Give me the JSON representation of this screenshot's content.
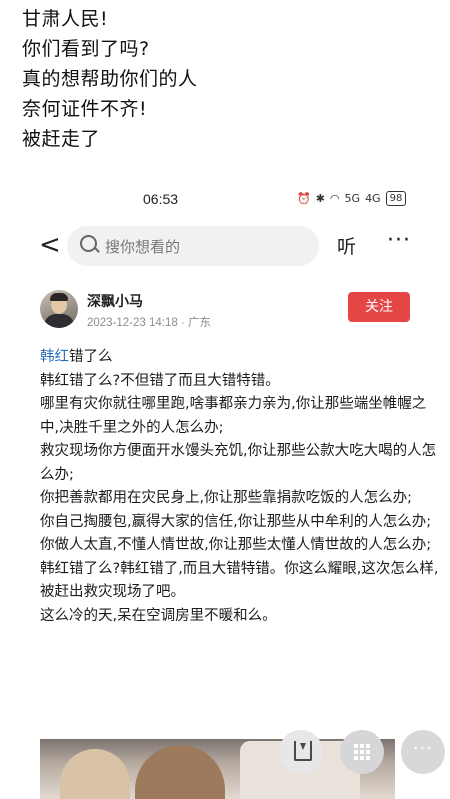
{
  "caption": {
    "lines": [
      "甘肃人民!",
      "你们看到了吗?",
      "真的想帮助你们的人",
      "奈何证件不齐!",
      "被赶走了"
    ]
  },
  "status_bar": {
    "time": "06:53",
    "icons": [
      "alarm-icon",
      "bluetooth-icon",
      "wifi-icon",
      "signal-5g-icon",
      "signal-4g-icon"
    ],
    "signal_5g": "5G",
    "signal_4g": "4G",
    "battery": "98"
  },
  "nav": {
    "back_label": "<",
    "search_placeholder": "搜你想看的",
    "listen_label": "听",
    "more_label": "···"
  },
  "author": {
    "name": "深飘小马",
    "meta": "2023-12-23 14:18 · 广东",
    "follow_label": "关注"
  },
  "article": {
    "topic": "韩红",
    "title_rest": "错了么",
    "paragraphs": [
      "韩红错了么?不但错了而且大错特错。",
      "哪里有灾你就往哪里跑,啥事都亲力亲为,你让那些端坐帷幄之中,决胜千里之外的人怎么办;",
      "救灾现场你方便面开水馒头充饥,你让那些公款大吃大喝的人怎么办;",
      "你把善款都用在灾民身上,你让那些靠捐款吃饭的人怎么办;",
      "你自己掏腰包,赢得大家的信任,你让那些从中牟利的人怎么办;",
      "你做人太直,不懂人情世故,你让那些太懂人情世故的人怎么办;",
      "韩红错了么?韩红错了,而且大错特错。你这么耀眼,这次怎么样,被赶出救灾现场了吧。",
      "这么冷的天,呆在空调房里不暖和么。"
    ]
  },
  "colors": {
    "accent_red": "#e44646",
    "topic_blue": "#2a6fb7"
  }
}
